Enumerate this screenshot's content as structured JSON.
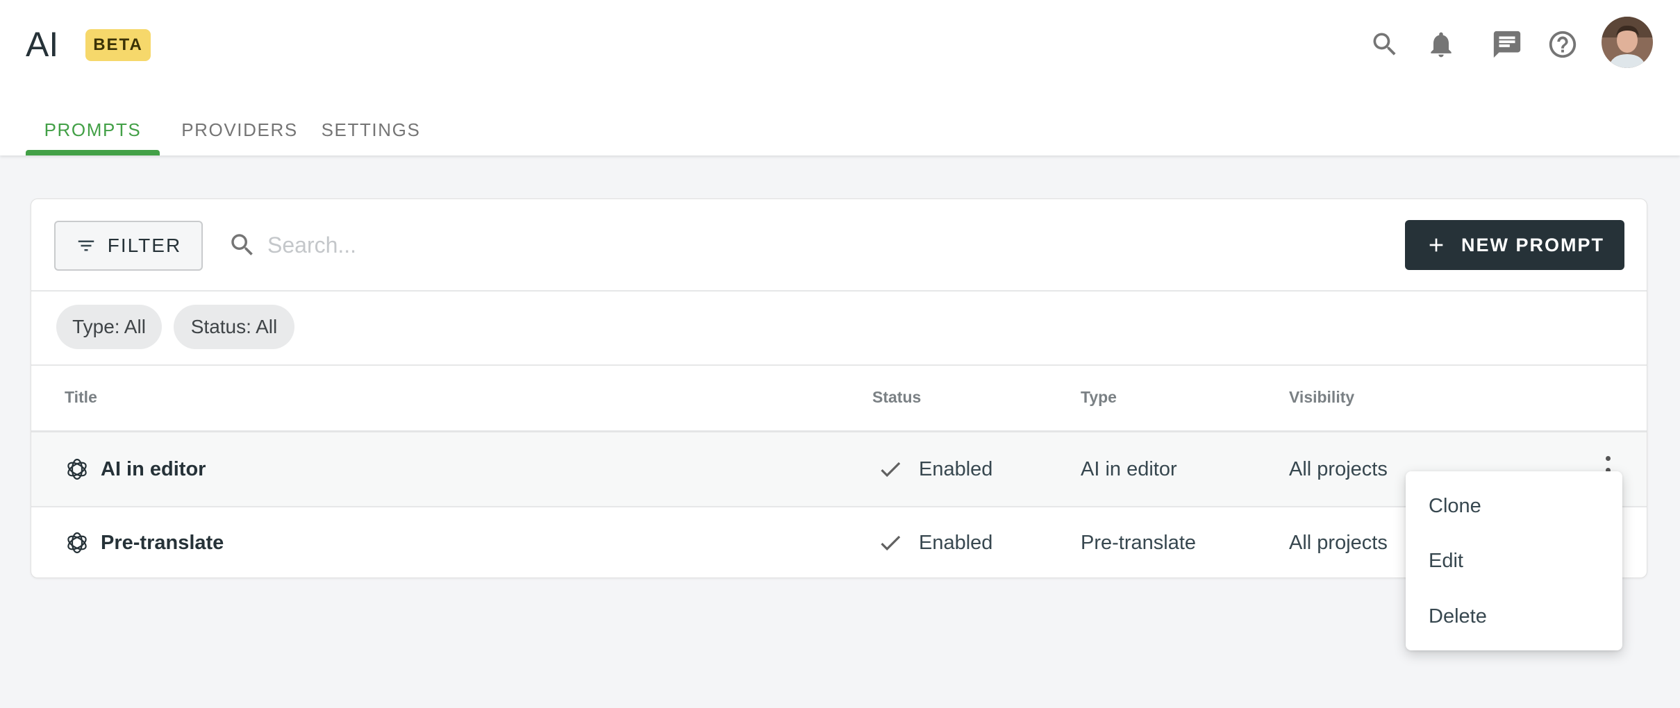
{
  "app": {
    "title": "AI",
    "badge": "BETA"
  },
  "header_icons": [
    "search-icon",
    "bell-icon",
    "chat-icon",
    "help-icon"
  ],
  "tabs": [
    {
      "label": "PROMPTS",
      "active": true
    },
    {
      "label": "PROVIDERS",
      "active": false
    },
    {
      "label": "SETTINGS",
      "active": false
    }
  ],
  "toolbar": {
    "filter_label": "FILTER",
    "search_placeholder": "Search...",
    "search_value": "",
    "new_label": "NEW PROMPT"
  },
  "chips": [
    "Type: All",
    "Status: All"
  ],
  "table": {
    "columns": [
      "Title",
      "Status",
      "Type",
      "Visibility"
    ],
    "rows": [
      {
        "title": "AI in editor",
        "status": "Enabled",
        "type": "AI in editor",
        "visibility": "All projects",
        "icon": "openai-icon"
      },
      {
        "title": "Pre-translate",
        "status": "Enabled",
        "type": "Pre-translate",
        "visibility": "All projects",
        "icon": "openai-icon"
      }
    ]
  },
  "menu": {
    "items": [
      "Clone",
      "Edit",
      "Delete"
    ]
  },
  "colors": {
    "accent": "#43a047",
    "dark": "#263238",
    "badge": "#f6d86b"
  }
}
